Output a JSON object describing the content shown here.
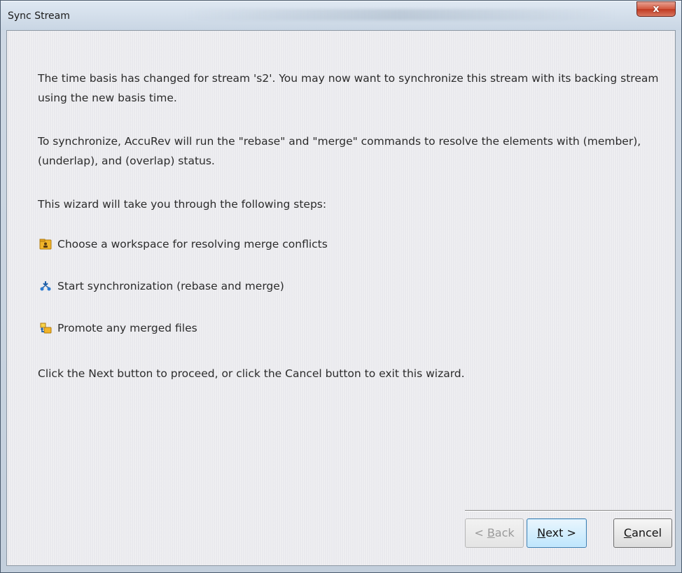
{
  "window": {
    "title": "Sync Stream",
    "close_label": "x"
  },
  "body": {
    "intro": "The time basis has changed for stream 's2'. You may now want to synchronize this stream with its backing stream using the new basis time.",
    "sync_info": "To synchronize, AccuRev will run the \"rebase\" and \"merge\" commands to resolve the elements with (member), (underlap), and (overlap) status.",
    "steps_intro": "This wizard will take you through the following steps:",
    "steps": [
      {
        "label": "Choose a workspace for resolving merge conflicts",
        "icon": "workspace-folder-icon"
      },
      {
        "label": "Start synchronization (rebase and merge)",
        "icon": "synchronize-icon"
      },
      {
        "label": "Promote any merged files",
        "icon": "promote-icon"
      }
    ],
    "outro": "Click the Next button to proceed, or click the Cancel button to exit this wizard."
  },
  "buttons": {
    "back": {
      "prefix": "< ",
      "mnemonic": "B",
      "rest": "ack",
      "enabled": false
    },
    "next": {
      "mnemonic": "N",
      "rest": "ext >",
      "enabled": true
    },
    "cancel": {
      "mnemonic": "C",
      "rest": "ancel",
      "enabled": true
    }
  },
  "colors": {
    "close_button": "#c9452c",
    "next_button_highlight": "#bee6fd"
  }
}
